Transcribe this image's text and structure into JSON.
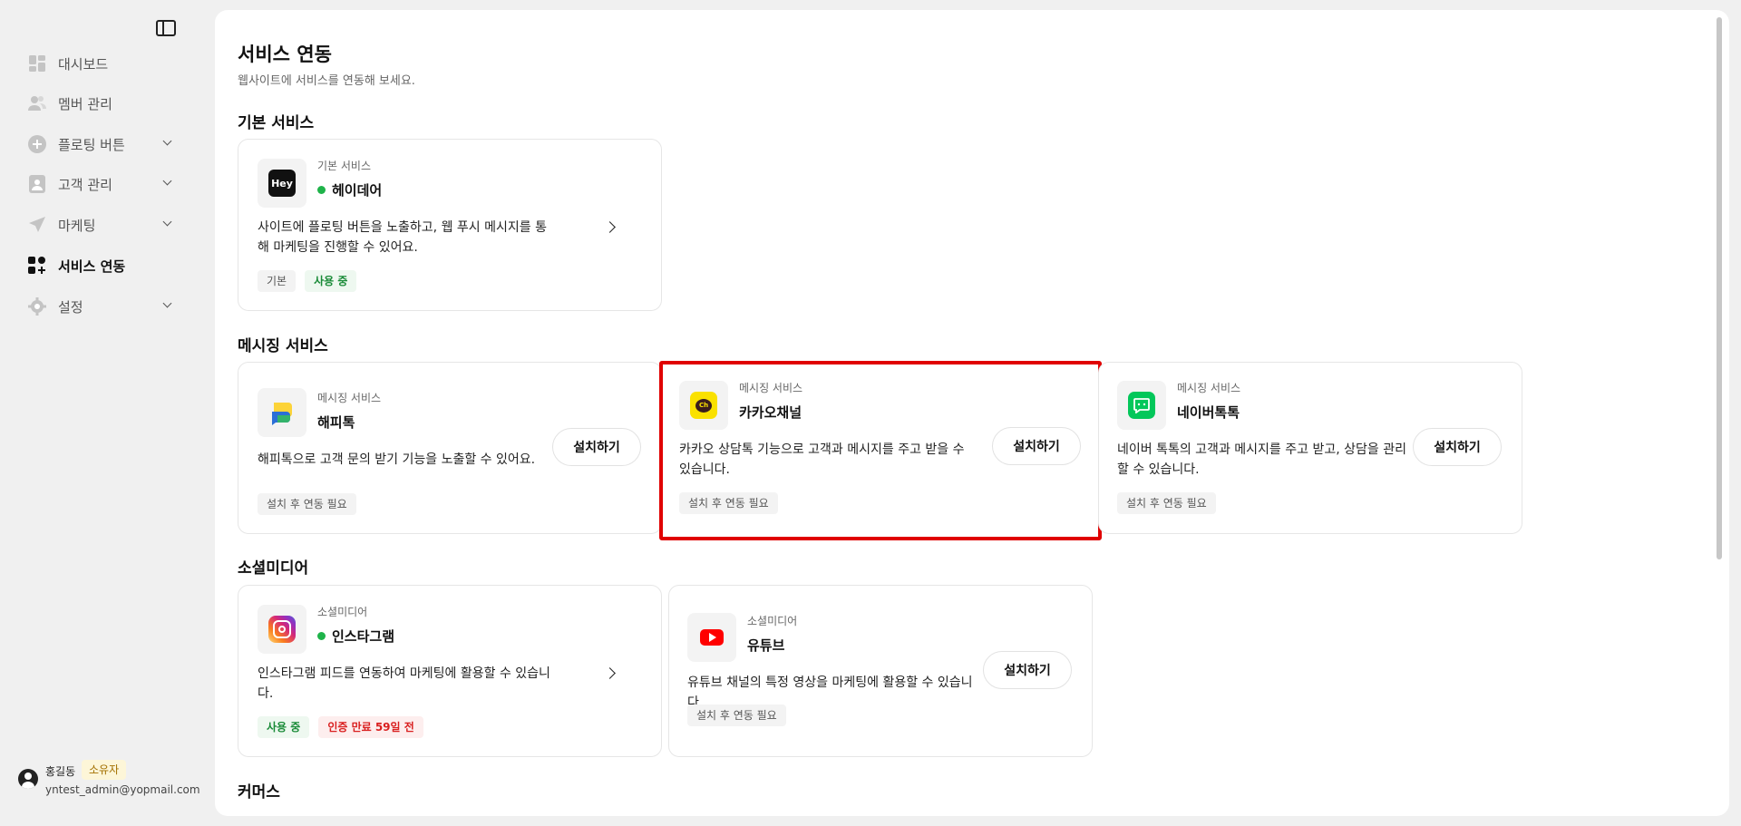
{
  "sidebar": {
    "items": [
      {
        "label": "대시보드",
        "icon": "dashboard-icon"
      },
      {
        "label": "멤버 관리",
        "icon": "members-icon"
      },
      {
        "label": "플로팅 버튼",
        "icon": "plus-circle-icon"
      },
      {
        "label": "고객 관리",
        "icon": "customer-icon"
      },
      {
        "label": "마케팅",
        "icon": "send-icon"
      },
      {
        "label": "서비스 연동",
        "icon": "integration-icon"
      },
      {
        "label": "설정",
        "icon": "gear-icon"
      }
    ],
    "user": {
      "name": "홍길동",
      "role": "소유자",
      "email": "yntest_admin@yopmail.com"
    }
  },
  "page": {
    "title": "서비스 연동",
    "subtitle": "웹사이트에 서비스를 연동해 보세요."
  },
  "sections": {
    "basic": "기본 서비스",
    "messaging": "메시징 서비스",
    "social": "소셜미디어",
    "commerce": "커머스"
  },
  "cards": {
    "heydear": {
      "logo_text": "Hey",
      "category": "기본 서비스",
      "name": "헤이데어",
      "desc": "사이트에 플로팅 버튼을 노출하고, 웹 푸시 메시지를 통해 마케팅을 진행할 수 있어요.",
      "tags": [
        "기본",
        "사용 중"
      ]
    },
    "happytalk": {
      "category": "메시징 서비스",
      "name": "해피톡",
      "desc": "해피톡으로 고객 문의 받기 기능을 노출할 수 있어요.",
      "tag": "설치 후 연동 필요",
      "button": "설치하기"
    },
    "kakao": {
      "logo_text": "Ch",
      "category": "메시징 서비스",
      "name": "카카오채널",
      "desc": "카카오 상담톡 기능으로 고객과 메시지를 주고 받을 수 있습니다.",
      "tag": "설치 후 연동 필요",
      "button": "설치하기"
    },
    "naver": {
      "category": "메시징 서비스",
      "name": "네이버톡톡",
      "desc": "네이버 톡톡의 고객과 메시지를 주고 받고, 상담을 관리할 수 있습니다.",
      "tag": "설치 후 연동 필요",
      "button": "설치하기"
    },
    "instagram": {
      "category": "소셜미디어",
      "name": "인스타그램",
      "desc": "인스타그램 피드를 연동하여 마케팅에 활용할 수 있습니다.",
      "tags": [
        "사용 중",
        "인증 만료 59일 전"
      ]
    },
    "youtube": {
      "category": "소셜미디어",
      "name": "유튜브",
      "desc": "유튜브 채널의 특정 영상을 마케팅에 활용할 수 있습니다.",
      "tag": "설치 후 연동 필요",
      "button": "설치하기"
    }
  },
  "colors": {
    "active_dot": "#1fb34a",
    "highlight": "#e00000",
    "kakao_yellow": "#fae100",
    "naver_green": "#03c75a",
    "youtube_red": "#ff0000"
  }
}
